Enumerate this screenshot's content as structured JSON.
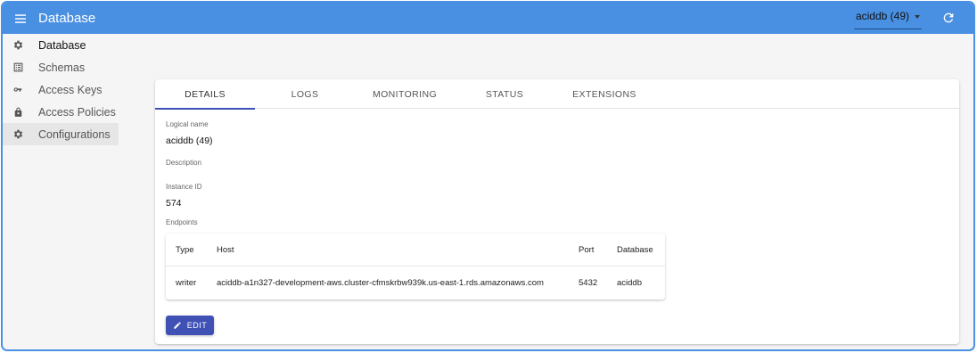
{
  "app": {
    "title": "Database"
  },
  "header": {
    "db_selector": "aciddb (49)"
  },
  "sidebar": {
    "items": [
      {
        "label": "Database",
        "icon": "gear-icon"
      },
      {
        "label": "Schemas",
        "icon": "list-icon"
      },
      {
        "label": "Access Keys",
        "icon": "key-icon"
      },
      {
        "label": "Access Policies",
        "icon": "lock-icon"
      },
      {
        "label": "Configurations",
        "icon": "gear-icon"
      }
    ]
  },
  "tabs": [
    "DETAILS",
    "LOGS",
    "MONITORING",
    "STATUS",
    "EXTENSIONS"
  ],
  "details": {
    "logical_name_label": "Logical name",
    "logical_name": "aciddb (49)",
    "description_label": "Description",
    "instance_id_label": "Instance ID",
    "instance_id": "574",
    "endpoints_label": "Endpoints"
  },
  "endpoints": {
    "headers": {
      "type": "Type",
      "host": "Host",
      "port": "Port",
      "database": "Database"
    },
    "rows": [
      {
        "type": "writer",
        "host": "aciddb-a1n327-development-aws.cluster-cfmskrbw939k.us-east-1.rds.amazonaws.com",
        "port": "5432",
        "database": "aciddb"
      }
    ]
  },
  "actions": {
    "edit_label": "EDIT"
  },
  "colors": {
    "appbar": "#4a90e2",
    "primary": "#3f51b5"
  }
}
